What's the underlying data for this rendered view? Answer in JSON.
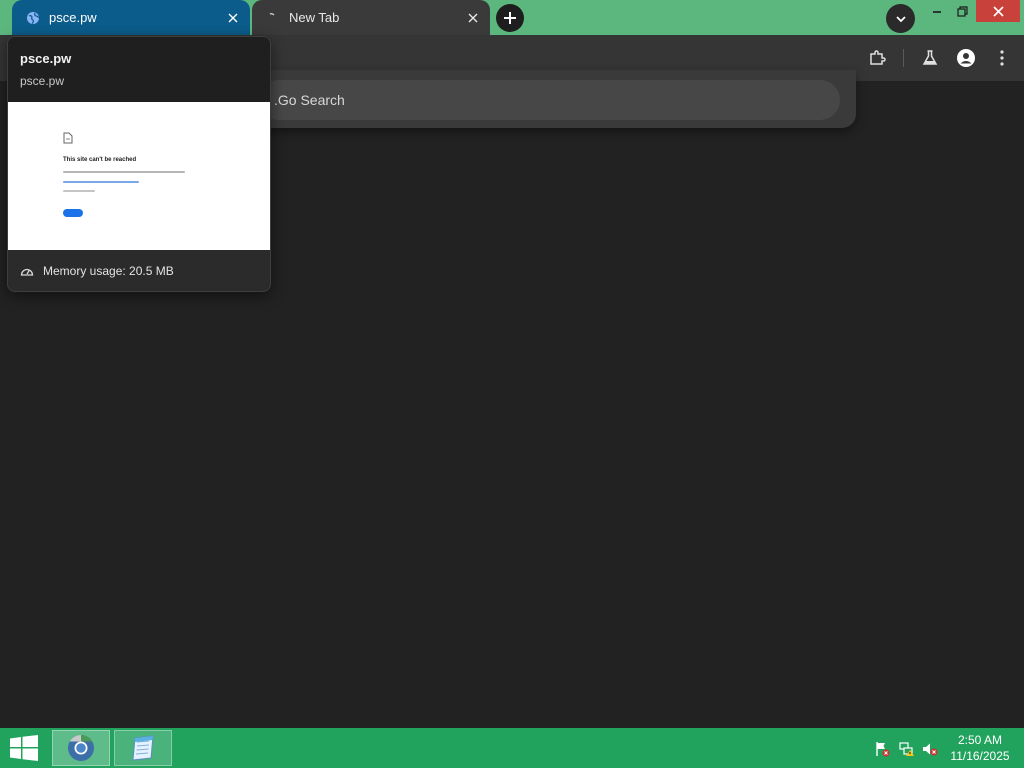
{
  "tabs": [
    {
      "title": "psce.pw",
      "close_icon": "close-icon",
      "favicon": "globe-icon"
    },
    {
      "title": "New Tab",
      "close_icon": "close-icon",
      "favicon": "chrome-icon"
    }
  ],
  "omnibox": {
    "value": ".Go Search",
    "placeholder": ""
  },
  "hovercard": {
    "title": "psce.pw",
    "domain": "psce.pw",
    "preview_heading": "This site can't be reached",
    "memory": "Memory usage: 20.5 MB"
  },
  "taskbar": {
    "time": "2:50 AM",
    "date": "11/16/2025"
  },
  "colors": {
    "frame_accent": "#5cb77f",
    "active_tab": "#0b5c8a",
    "taskbar": "#21a35e",
    "close_button": "#c8413a"
  }
}
